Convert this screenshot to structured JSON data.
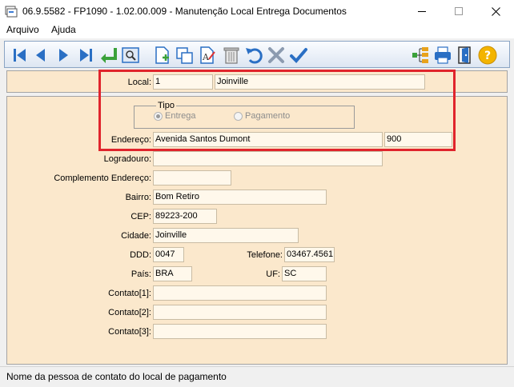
{
  "window": {
    "title": "06.9.5582 - FP1090 - 1.02.00.009 - Manutenção Local Entrega Documentos"
  },
  "menu": {
    "arquivo": "Arquivo",
    "ajuda": "Ajuda"
  },
  "toolbar": {
    "icons": [
      "first-record-icon",
      "previous-record-icon",
      "next-record-icon",
      "last-record-icon",
      "goto-icon",
      "zoom-icon",
      "new-icon",
      "copy-icon",
      "edit-icon",
      "delete-icon",
      "undo-icon",
      "cancel-icon",
      "confirm-icon",
      "tree-icon",
      "print-icon",
      "exit-icon",
      "help-icon"
    ]
  },
  "form": {
    "local_label": "Local:",
    "local_code": "1",
    "local_name": "Joinville",
    "tipo_label": "Tipo",
    "tipo_options": [
      "Entrega",
      "Pagamento"
    ],
    "tipo_selected": "Entrega",
    "endereco_label": "Endereço:",
    "endereco_value": "Avenida Santos Dumont",
    "numero_value": "900",
    "logradouro_label": "Logradouro:",
    "logradouro_value": "",
    "complemento_label": "Complemento Endereço:",
    "complemento_value": "",
    "bairro_label": "Bairro:",
    "bairro_value": "Bom Retiro",
    "cep_label": "CEP:",
    "cep_value": "89223-200",
    "cidade_label": "Cidade:",
    "cidade_value": "Joinville",
    "ddd_label": "DDD:",
    "ddd_value": "0047",
    "telefone_label": "Telefone:",
    "telefone_value": "03467.4561",
    "pais_label": "País:",
    "pais_value": "BRA",
    "uf_label": "UF:",
    "uf_value": "SC",
    "contato1_label": "Contato[1]:",
    "contato1_value": "",
    "contato2_label": "Contato[2]:",
    "contato2_value": "",
    "contato3_label": "Contato[3]:",
    "contato3_value": ""
  },
  "status": {
    "text": "Nome da pessoa de contato do local de pagamento"
  },
  "colors": {
    "panel_bg": "#fbe8cc",
    "field_bg": "#fff8eb",
    "highlight": "#e0242c",
    "toolbar_icon": "#2a6fc4"
  }
}
